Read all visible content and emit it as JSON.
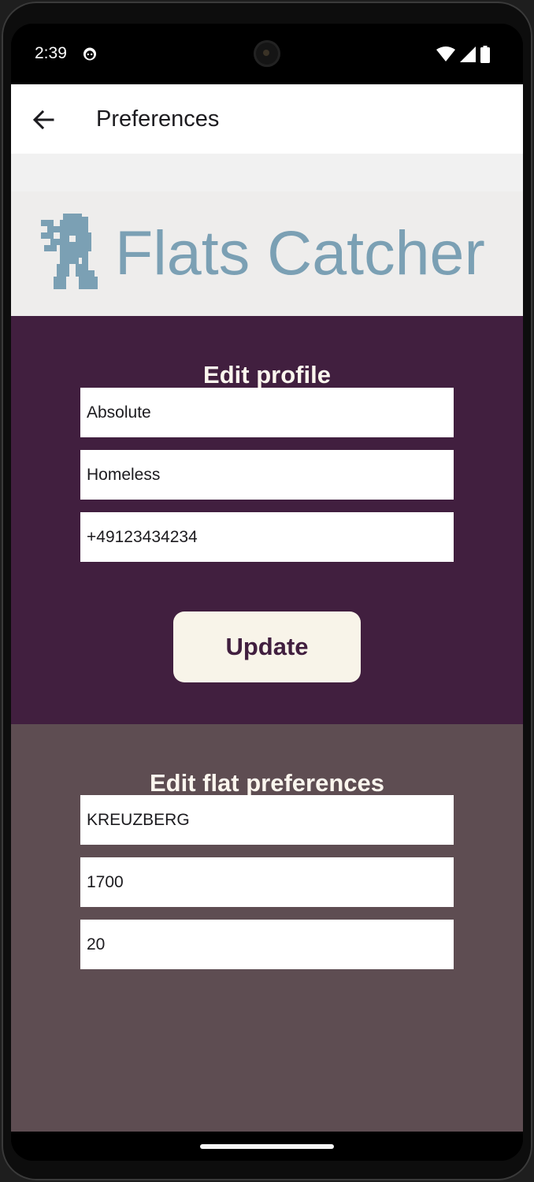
{
  "status_bar": {
    "time": "2:39"
  },
  "app_bar": {
    "title": "Preferences",
    "back_icon": "arrow-back-icon"
  },
  "logo": {
    "text": "Flats Catcher",
    "icon": "berlin-bear-icon",
    "color": "#7ba0b4"
  },
  "profile": {
    "title": "Edit profile",
    "fields": [
      {
        "value": "Absolute"
      },
      {
        "value": "Homeless"
      },
      {
        "value": "+49123434234"
      }
    ],
    "update_label": "Update"
  },
  "flat_preferences": {
    "title": "Edit flat preferences",
    "fields": [
      {
        "value": "KREUZBERG"
      },
      {
        "value": "1700"
      },
      {
        "value": "20"
      }
    ]
  },
  "colors": {
    "profile_bg": "#411f3f",
    "prefs_bg": "#5e4d52",
    "button_bg": "#f8f4e9"
  }
}
